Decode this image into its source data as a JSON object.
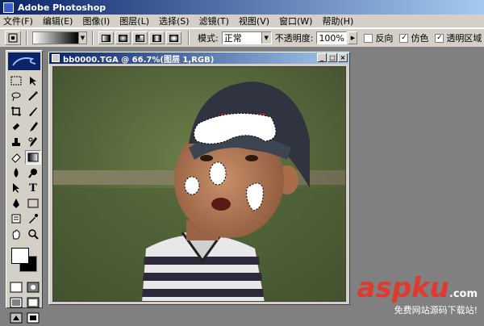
{
  "app": {
    "title": "Adobe Photoshop"
  },
  "menu": [
    "文件(F)",
    "编辑(E)",
    "图像(I)",
    "图层(L)",
    "选择(S)",
    "滤镜(T)",
    "视图(V)",
    "窗口(W)",
    "帮助(H)"
  ],
  "options": {
    "mode_label": "模式:",
    "mode_value": "正常",
    "opacity_label": "不透明度:",
    "opacity_value": "100%",
    "reverse_label": "反向",
    "dither_label": "仿色",
    "transparency_label": "透明区域",
    "reverse_checked": false,
    "dither_checked": true,
    "transparency_checked": true
  },
  "document": {
    "title": "bb0000.TGA @ 66.7%(图层 1,RGB)"
  },
  "watermark": {
    "brand": "aspku",
    "tld": ".com",
    "tagline": "免费网站源码下载站!"
  },
  "colors": {
    "brand_red": "#e03a2f",
    "titlebar": "#0a246a",
    "chrome": "#d4d0c8"
  }
}
